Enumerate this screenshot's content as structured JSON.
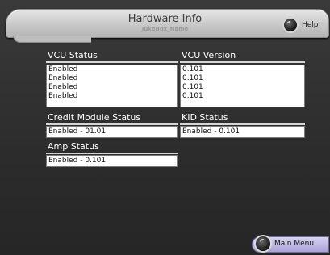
{
  "header": {
    "title": "Hardware Info",
    "subtitle": "JukeBox_Name",
    "help_label": "Help"
  },
  "vcu_status": {
    "label": "VCU Status",
    "lines": [
      "Enabled",
      "Enabled",
      "Enabled",
      "Enabled"
    ]
  },
  "vcu_version": {
    "label": "VCU Version",
    "lines": [
      "0.101",
      "0.101",
      "0.101",
      "0.101"
    ]
  },
  "credit_module": {
    "label": "Credit Module Status",
    "value": "Enabled - 01.01"
  },
  "kid_status": {
    "label": "KID Status",
    "value": "Enabled - 0.101"
  },
  "amp_status": {
    "label": "Amp Status",
    "value": "Enabled - 0.101"
  },
  "footer": {
    "main_menu_label": "Main Menu"
  }
}
